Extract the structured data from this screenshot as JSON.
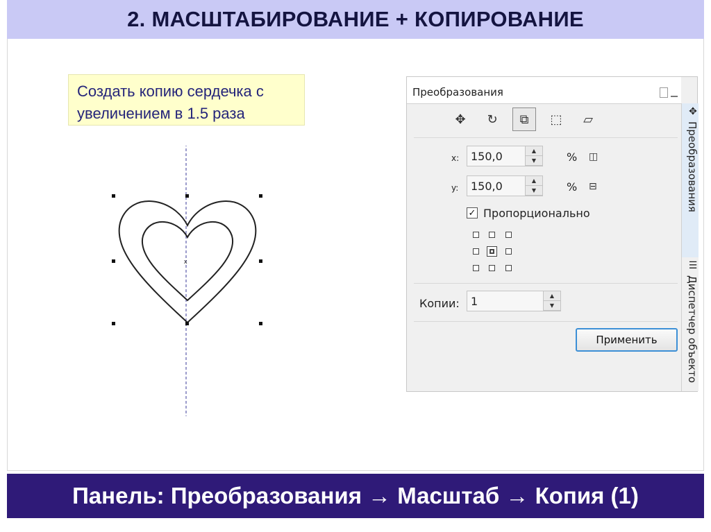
{
  "slide": {
    "title": "2. МАСШТАБИРОВАНИЕ + КОПИРОВАНИЕ",
    "note": "Создать копию сердечка с увеличением в 1.5 раза",
    "footer": "Панель: Преобразования → Масштаб → Копия (1)"
  },
  "dialog": {
    "title": "Преобразования",
    "tools": [
      "move-icon",
      "rotate-icon",
      "scale-icon",
      "size-icon",
      "skew-icon"
    ],
    "x_label": "x:",
    "x_value": "150,0",
    "y_label": "y:",
    "y_value": "150,0",
    "unit": "%",
    "proportional_checked": true,
    "proportional_label": "Пропорционально",
    "copies_label": "Копии:",
    "copies_value": "1",
    "apply_label": "Применить",
    "side_tabs": [
      "Преобразования",
      "Диспетчер объекто"
    ]
  },
  "colors": {
    "title_bg": "#c9c9f5",
    "footer_bg": "#2f1a78",
    "note_bg": "#ffffcc",
    "apply_border": "#3c8fd6"
  }
}
